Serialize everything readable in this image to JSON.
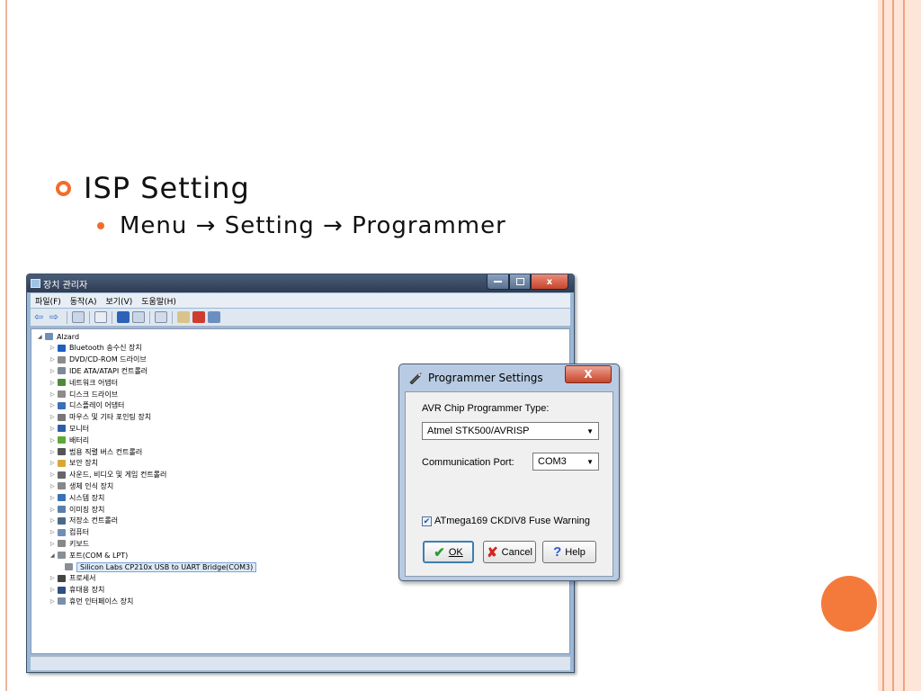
{
  "slide": {
    "heading": "ISP Setting",
    "subheading": "Menu → Setting → Programmer"
  },
  "device_manager": {
    "title": "장치 관리자",
    "window_controls": {
      "close": "x"
    },
    "menu": [
      "파일(F)",
      "동작(A)",
      "보기(V)",
      "도움말(H)"
    ],
    "tree": [
      {
        "label": "Alzard",
        "icon": "computer-icon"
      },
      {
        "label": "Bluetooth 송수신 장치",
        "icon": "bluetooth-icon"
      },
      {
        "label": "DVD/CD-ROM 드라이브",
        "icon": "dvd-drive-icon"
      },
      {
        "label": "IDE ATA/ATAPI 컨트롤러",
        "icon": "ide-controller-icon"
      },
      {
        "label": "네트워크 어댑터",
        "icon": "network-adapter-icon"
      },
      {
        "label": "디스크 드라이브",
        "icon": "disk-drive-icon"
      },
      {
        "label": "디스플레이 어댑터",
        "icon": "display-adapter-icon"
      },
      {
        "label": "마우스 및 기타 포인팅 장치",
        "icon": "mouse-icon"
      },
      {
        "label": "모니터",
        "icon": "monitor-icon"
      },
      {
        "label": "배터리",
        "icon": "battery-icon"
      },
      {
        "label": "범용 직렬 버스 컨트롤러",
        "icon": "usb-icon"
      },
      {
        "label": "보안 장치",
        "icon": "security-icon"
      },
      {
        "label": "사운드, 비디오 및 게임 컨트롤러",
        "icon": "sound-icon"
      },
      {
        "label": "생체 인식 장치",
        "icon": "biometric-icon"
      },
      {
        "label": "시스템 장치",
        "icon": "system-icon"
      },
      {
        "label": "이미징 장치",
        "icon": "imaging-icon"
      },
      {
        "label": "저장소 컨트롤러",
        "icon": "storage-icon"
      },
      {
        "label": "컴퓨터",
        "icon": "computer-icon"
      },
      {
        "label": "키보드",
        "icon": "keyboard-icon"
      },
      {
        "label": "포트(COM & LPT)",
        "icon": "port-icon"
      },
      {
        "label": "Silicon Labs CP210x USB to UART Bridge(COM3)",
        "icon": "port-icon",
        "selected": true
      },
      {
        "label": "프로세서",
        "icon": "processor-icon"
      },
      {
        "label": "휴대용 장치",
        "icon": "portable-device-icon"
      },
      {
        "label": "휴먼 인터페이스 장치",
        "icon": "hid-icon"
      }
    ]
  },
  "programmer_settings": {
    "title": "Programmer Settings",
    "close_label": "X",
    "chip_type_label": "AVR Chip Programmer Type:",
    "chip_type_value": "Atmel STK500/AVRISP",
    "port_label": "Communication Port:",
    "port_value": "COM3",
    "fuse_warning_label": "ATmega169 CKDIV8 Fuse Warning",
    "fuse_warning_checked": true,
    "buttons": {
      "ok": "OK",
      "cancel": "Cancel",
      "help": "Help"
    }
  },
  "colors": {
    "accent_orange": "#f26d2b",
    "frame_peach": "#fde5d8"
  }
}
